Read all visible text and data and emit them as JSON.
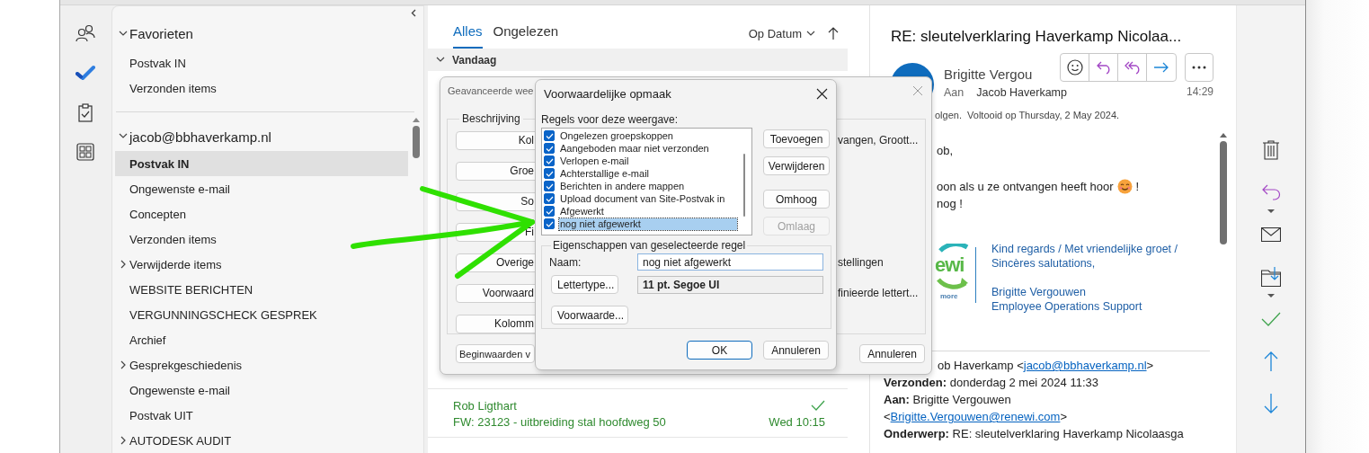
{
  "folder_pane": {
    "sections": [
      {
        "label": "Favorieten",
        "expanded": true,
        "folders": [
          {
            "label": "Postvak IN",
            "selected": false,
            "expandable": false
          },
          {
            "label": "Verzonden items",
            "selected": false,
            "expandable": false
          }
        ]
      },
      {
        "label": "jacob@bbhaverkamp.nl",
        "expanded": true,
        "folders": [
          {
            "label": "Postvak IN",
            "selected": true,
            "expandable": false
          },
          {
            "label": "Ongewenste e-mail",
            "selected": false,
            "expandable": false
          },
          {
            "label": "Concepten",
            "selected": false,
            "expandable": false
          },
          {
            "label": "Verzonden items",
            "selected": false,
            "expandable": false
          },
          {
            "label": "Verwijderde items",
            "selected": false,
            "expandable": true
          },
          {
            "label": "WEBSITE BERICHTEN",
            "selected": false,
            "expandable": false
          },
          {
            "label": "VERGUNNINGSCHECK GESPREK",
            "selected": false,
            "expandable": false
          },
          {
            "label": "Archief",
            "selected": false,
            "expandable": false
          },
          {
            "label": "Gesprekgeschiedenis",
            "selected": false,
            "expandable": true
          },
          {
            "label": "Ongewenste e-mail",
            "selected": false,
            "expandable": false
          },
          {
            "label": "Postvak UIT",
            "selected": false,
            "expandable": false
          },
          {
            "label": "AUTODESK AUDIT",
            "selected": false,
            "expandable": true
          }
        ]
      }
    ]
  },
  "message_list": {
    "tabs": [
      {
        "label": "Alles",
        "selected": true
      },
      {
        "label": "Ongelezen",
        "selected": false
      }
    ],
    "sort": "Op Datum",
    "groups": [
      {
        "label": "Vandaag",
        "expanded": true
      }
    ],
    "messages": [
      {
        "sender": "Rob Ligthart",
        "subject": "FW: 23123 - uitbreiding stal hoofdweg 50",
        "time": "Wed 10:15",
        "completed": true
      }
    ]
  },
  "reading_pane": {
    "title": "RE: sleutelverklaring Haverkamp Nicolaa...",
    "sender": "Brigitte Vergou",
    "to_label": "Aan",
    "recipient": "Jacob Haverkamp",
    "time": "14:29",
    "flag_status": "olgen.  Voltooid op Thursday, 2 May 2024.",
    "body": [
      {
        "text": "ob,",
        "emoji": false
      },
      {
        "text": "oon als u ze ontvangen heeft hoor",
        "emoji": true,
        "after": "!"
      },
      {
        "text": "nog !",
        "emoji": false
      }
    ],
    "logo": {
      "text": "ewi",
      "tagline": "more"
    },
    "signature": [
      {
        "lines": [
          "Kind regards / Met vriendelijke groet /",
          "Sincères salutations,"
        ]
      },
      {
        "lines": [
          "Brigitte Vergouwen",
          "Employee Operations Support"
        ]
      }
    ],
    "quoted_header": [
      {
        "text": "ob Haverkamp <",
        "link": "jacob@bbhaverkamp.nl",
        "after": ">"
      },
      {
        "text": "**Verzonden:** donderdag 2 mei 2024 11:33"
      },
      {
        "text": "**Aan:** Brigitte Vergouwen"
      },
      {
        "text": "<",
        "link": "Brigitte.Vergouwen@renewi.com",
        "after": ">"
      },
      {
        "text": "**Onderwerp:** RE: sleutelverklaring Haverkamp Nicolaasga"
      }
    ]
  },
  "dialogs": {
    "advanced_view": {
      "title": "Geavanceerde wee",
      "group_label": "Beschrijving",
      "rows": [
        {
          "button": "Kol",
          "value": "vangen, Groott..."
        },
        {
          "button": "Groe"
        },
        {
          "button": "So"
        },
        {
          "button": "Fi"
        },
        {
          "button": "Overige",
          "value": "stellingen"
        },
        {
          "button": "Voorwaard",
          "value": "finieerde lettert..."
        },
        {
          "button": "Kolomm"
        }
      ],
      "reset_button": "Beginwaarden v",
      "cancel_button": "Annuleren"
    },
    "conditional_formatting": {
      "title": "Voorwaardelijke opmaak",
      "rules_label": "Regels voor deze weergave:",
      "rules": [
        {
          "label": "Ongelezen groepskoppen",
          "checked": true,
          "selected": false
        },
        {
          "label": "Aangeboden maar niet verzonden",
          "checked": true,
          "selected": false
        },
        {
          "label": "Verlopen e-mail",
          "checked": true,
          "selected": false
        },
        {
          "label": "Achterstallige e-mail",
          "checked": true,
          "selected": false
        },
        {
          "label": "Berichten in andere mappen",
          "checked": true,
          "selected": false
        },
        {
          "label": "Upload document van Site-Postvak in",
          "checked": true,
          "selected": false
        },
        {
          "label": "Afgewerkt",
          "checked": true,
          "selected": false
        },
        {
          "label": "nog niet afgewerkt",
          "checked": true,
          "selected": true
        }
      ],
      "side_buttons": [
        {
          "label": "Toevoegen",
          "disabled": false
        },
        {
          "label": "Verwijderen",
          "disabled": false
        },
        {
          "label": "Omhoog",
          "disabled": false
        },
        {
          "label": "Omlaag",
          "disabled": true
        }
      ],
      "properties": {
        "label": "Eigenschappen van geselecteerde regel",
        "name_label": "Naam:",
        "name_value": "nog niet afgewerkt",
        "font_button": "Lettertype...",
        "font_value": "11 pt. Segoe UI",
        "condition_button": "Voorwaarde..."
      },
      "ok_button": "OK",
      "cancel_button": "Annuleren"
    }
  }
}
